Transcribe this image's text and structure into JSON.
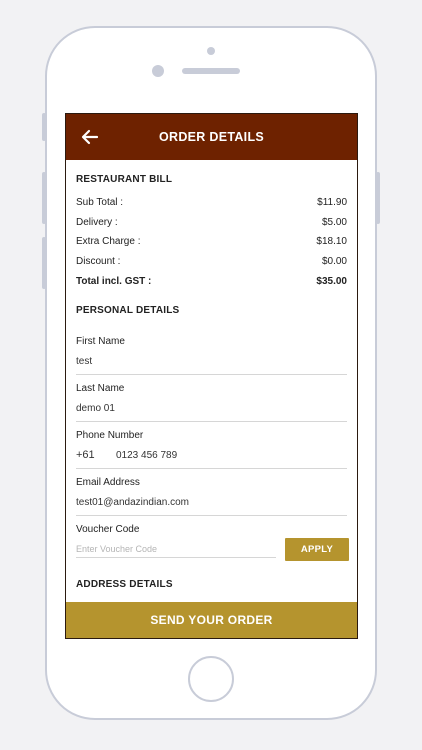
{
  "header": {
    "title": "ORDER DETAILS",
    "back_icon": "arrow-left-icon"
  },
  "restaurant_bill": {
    "title": "RESTAURANT BILL",
    "rows": [
      {
        "label": "Sub Total :",
        "value": "$11.90"
      },
      {
        "label": "Delivery :",
        "value": "$5.00"
      },
      {
        "label": "Extra Charge :",
        "value": "$18.10"
      },
      {
        "label": "Discount :",
        "value": "$0.00"
      },
      {
        "label": "Total incl. GST :",
        "value": "$35.00"
      }
    ]
  },
  "personal_details": {
    "title": "PERSONAL DETAILS",
    "first_name": {
      "label": "First Name",
      "value": "test"
    },
    "last_name": {
      "label": "Last Name",
      "value": "demo 01"
    },
    "phone": {
      "label": "Phone Number",
      "code": "+61",
      "value": "0123 456 789"
    },
    "email": {
      "label": "Email Address",
      "value": "test01@andazindian.com"
    },
    "voucher": {
      "label": "Voucher Code",
      "placeholder": "Enter Voucher Code",
      "apply_label": "APPLY"
    }
  },
  "address_details": {
    "title": "ADDRESS DETAILS"
  },
  "footer": {
    "send_label": "SEND YOUR ORDER"
  },
  "colors": {
    "header": "#6e2200",
    "accent": "#b5942e",
    "phone_frame": "#c8ccd8"
  }
}
